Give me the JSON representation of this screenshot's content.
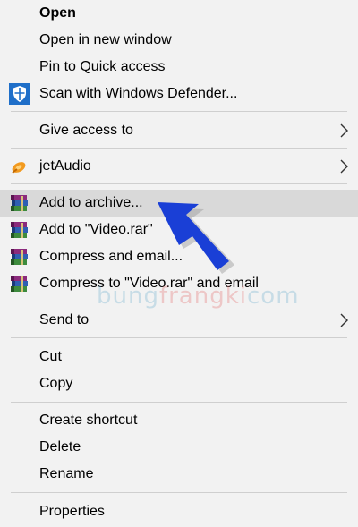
{
  "menu": {
    "items": [
      {
        "id": "open",
        "label": "Open"
      },
      {
        "id": "open_new_window",
        "label": "Open in new window"
      },
      {
        "id": "pin_quick_access",
        "label": "Pin to Quick access"
      },
      {
        "id": "scan_defender",
        "label": "Scan with Windows Defender...",
        "icon": "windows-defender-shield-icon"
      },
      {
        "id": "give_access",
        "label": "Give access to",
        "submenu": true
      },
      {
        "id": "jetaudio",
        "label": "jetAudio",
        "icon": "jetaudio-icon",
        "submenu": true
      },
      {
        "id": "add_archive",
        "label": "Add to archive...",
        "icon": "winrar-books-icon",
        "highlighted": true
      },
      {
        "id": "add_video_rar",
        "label": "Add to \"Video.rar\"",
        "icon": "winrar-books-icon"
      },
      {
        "id": "compress_email",
        "label": "Compress and email...",
        "icon": "winrar-books-icon"
      },
      {
        "id": "compress_video_email",
        "label": "Compress to \"Video.rar\" and email",
        "icon": "winrar-books-icon"
      },
      {
        "id": "send_to",
        "label": "Send to",
        "submenu": true
      },
      {
        "id": "cut",
        "label": "Cut"
      },
      {
        "id": "copy",
        "label": "Copy"
      },
      {
        "id": "create_shortcut",
        "label": "Create shortcut"
      },
      {
        "id": "delete",
        "label": "Delete"
      },
      {
        "id": "rename",
        "label": "Rename"
      },
      {
        "id": "properties",
        "label": "Properties"
      }
    ]
  },
  "watermark": {
    "part1": "bung",
    "part2": "frangki",
    "part3": "com"
  },
  "colors": {
    "menu_bg": "#f2f2f2",
    "highlight": "#d9d9d9",
    "arrow": "#1a3fd6"
  }
}
